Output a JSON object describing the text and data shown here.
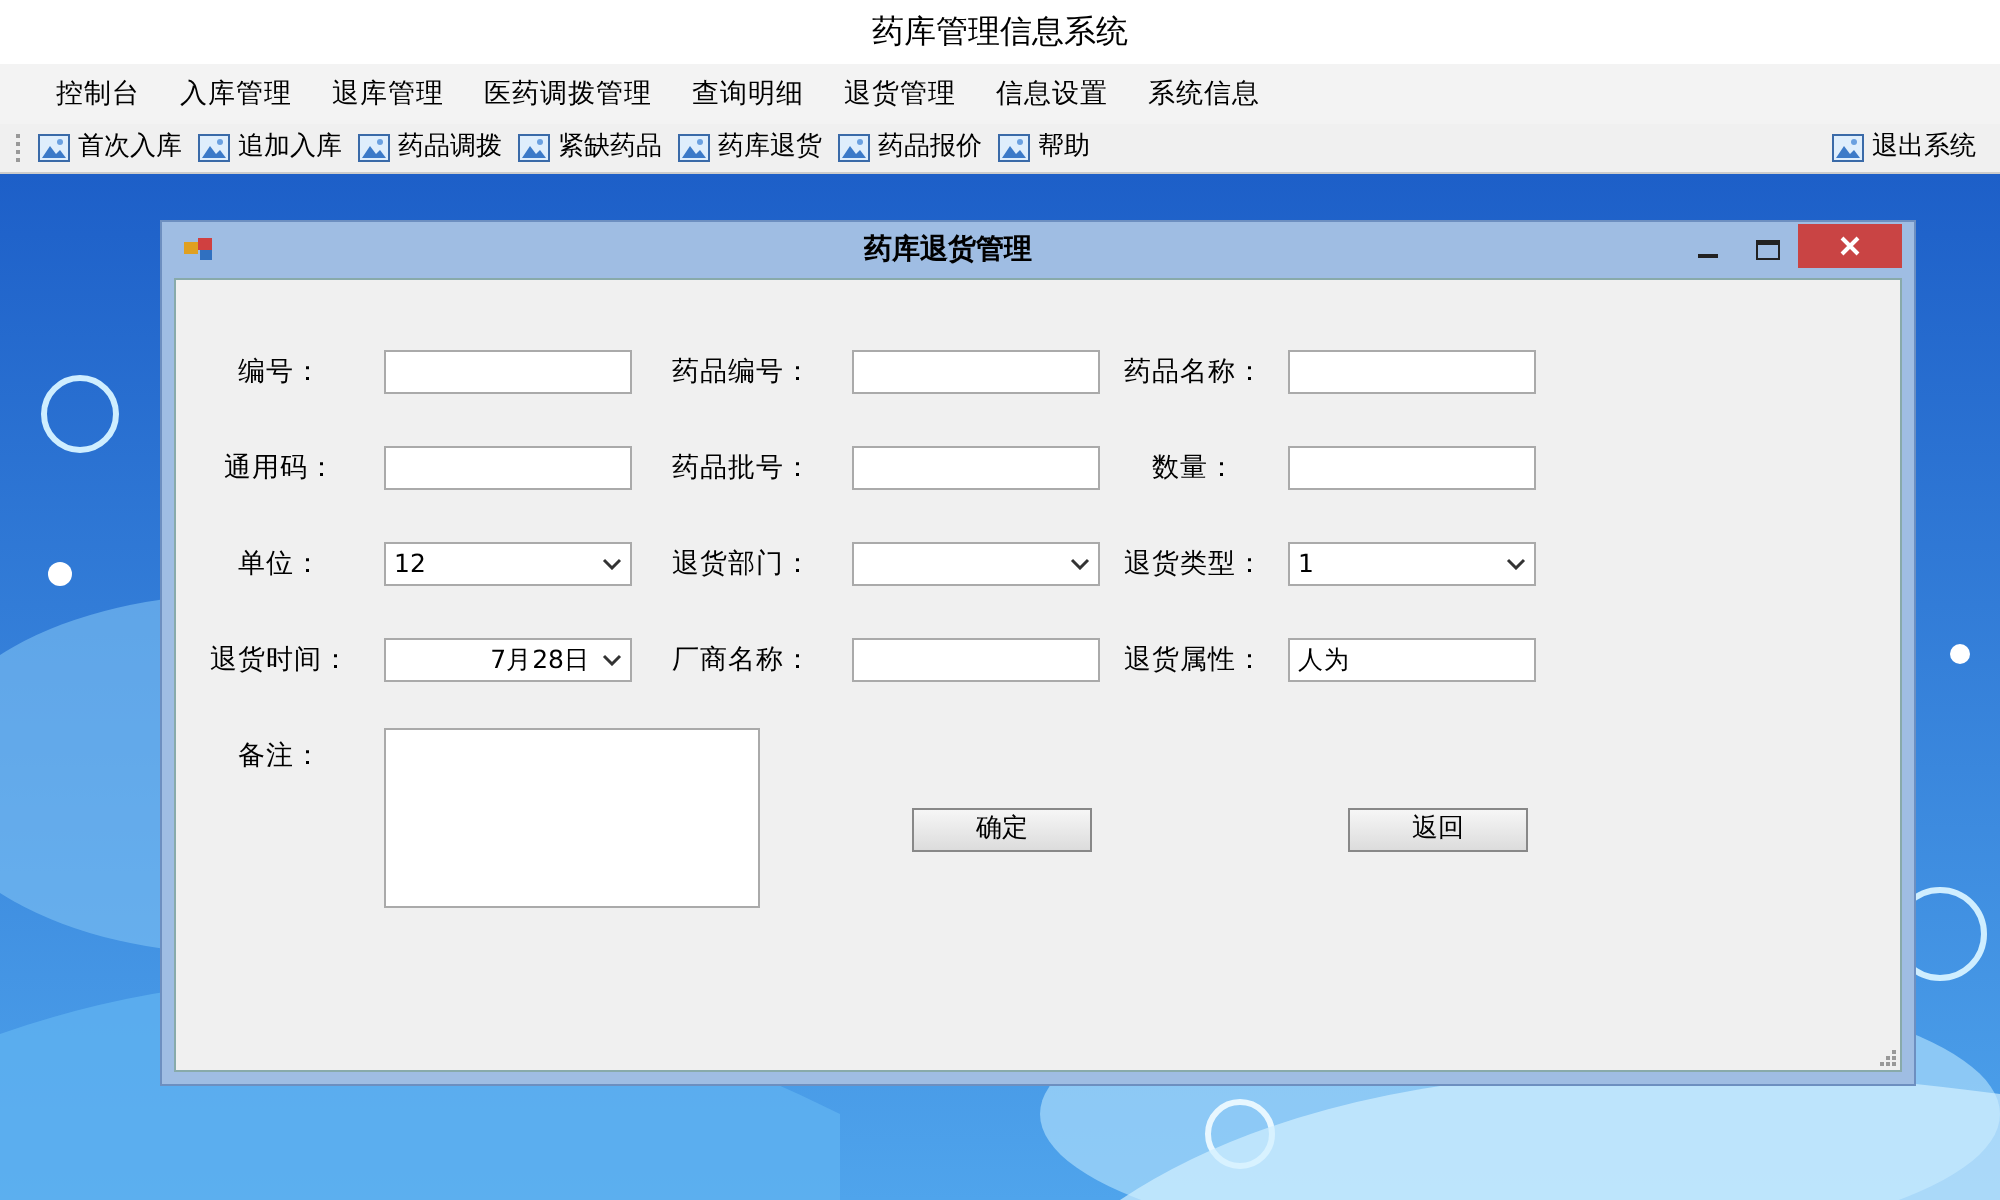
{
  "window": {
    "title": "药库管理信息系统"
  },
  "menu": [
    {
      "label": "控制台"
    },
    {
      "label": "入库管理"
    },
    {
      "label": "退库管理"
    },
    {
      "label": "医药调拨管理"
    },
    {
      "label": "查询明细"
    },
    {
      "label": "退货管理"
    },
    {
      "label": "信息设置"
    },
    {
      "label": "系统信息"
    }
  ],
  "toolbar": {
    "items": [
      {
        "label": "首次入库"
      },
      {
        "label": "追加入库"
      },
      {
        "label": "药品调拨"
      },
      {
        "label": "紧缺药品"
      },
      {
        "label": "药库退货"
      },
      {
        "label": "药品报价"
      },
      {
        "label": "帮助"
      }
    ],
    "right_item": {
      "label": "退出系统"
    }
  },
  "dialog": {
    "title": "药库退货管理",
    "rows": [
      [
        {
          "label": "编号：",
          "kind": "text"
        },
        {
          "label": "药品编号：",
          "kind": "text"
        },
        {
          "label": "药品名称：",
          "kind": "text"
        }
      ],
      [
        {
          "label": "通用码：",
          "kind": "text"
        },
        {
          "label": "药品批号：",
          "kind": "text"
        },
        {
          "label": "数量：",
          "kind": "text"
        }
      ],
      [
        {
          "label": "单位：",
          "kind": "select",
          "value": "12"
        },
        {
          "label": "退货部门：",
          "kind": "select"
        },
        {
          "label": "退货类型：",
          "kind": "select",
          "value": "1"
        }
      ],
      [
        {
          "label": "退货时间：",
          "kind": "date",
          "value": "7月28日"
        },
        {
          "label": "厂商名称：",
          "kind": "text"
        },
        {
          "label": "退货属性：",
          "kind": "text",
          "value": "人为"
        }
      ]
    ],
    "remark": {
      "label": "备注："
    },
    "buttons": [
      {
        "label": "确定"
      },
      {
        "label": "返回"
      }
    ]
  }
}
